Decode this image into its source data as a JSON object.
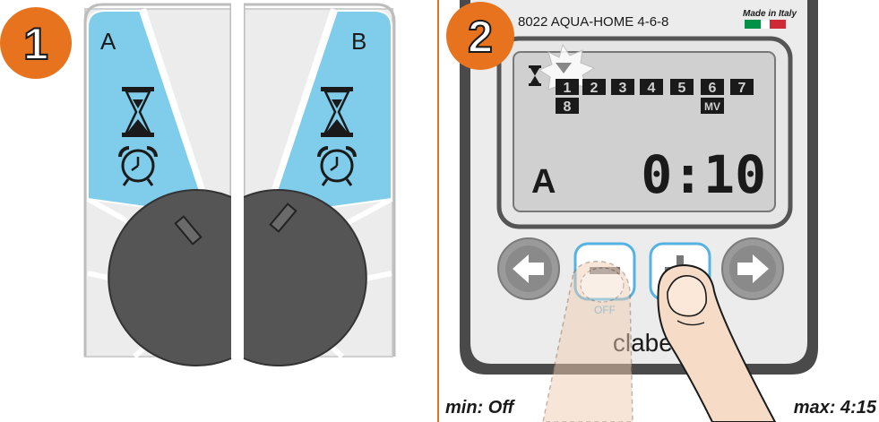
{
  "colors": {
    "step_badge": "#e8731f",
    "divider": "#e8731f",
    "panel_blue": "#7fcdeb",
    "panel_grey": "#ececec",
    "knob": "#555555",
    "lcd_bg": "#d0d0d0",
    "lcd_text": "#1a1a1a",
    "button_outline": "#54b3e3",
    "arrow_button": "#8a8a8a",
    "flag_green": "#009246",
    "flag_red": "#ce2b37"
  },
  "step1": {
    "badge": "1",
    "panel_left_label": "A",
    "panel_right_label": "B",
    "icons": [
      "hourglass-icon",
      "alarm-clock-icon"
    ]
  },
  "step2": {
    "badge": "2",
    "model_label": "8022  AQUA-HOME 4-6-8",
    "made_in": "Made in Italy",
    "lcd": {
      "stations": [
        "1",
        "2",
        "3",
        "4",
        "5",
        "6",
        "7"
      ],
      "station_extra": "8",
      "master_valve": "MV",
      "program": "A",
      "time": "0:10"
    },
    "buttons": {
      "minus_label": "OFF",
      "plus_label": "+",
      "minus_symbol": "−"
    },
    "brand": "claber"
  },
  "captions": {
    "min": "min: Off",
    "max": "max: 4:15"
  }
}
